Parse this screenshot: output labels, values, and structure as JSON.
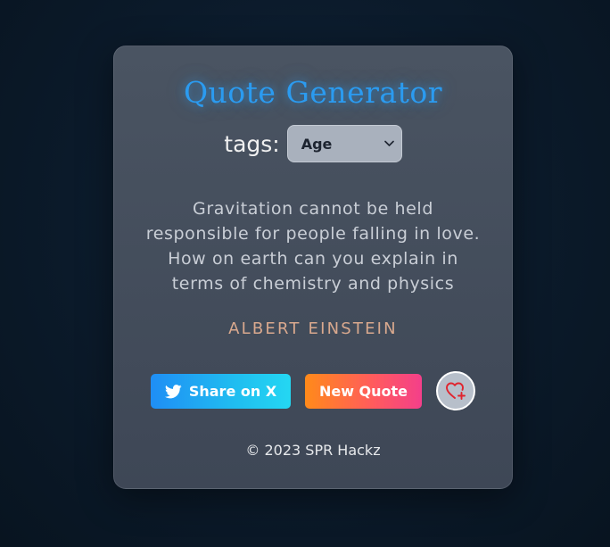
{
  "app": {
    "title": "Quote Generator"
  },
  "tags": {
    "label": "tags:",
    "selected": "Age"
  },
  "quote": {
    "text": "Gravitation cannot be held responsible for people falling in love. How on earth can you explain in terms of chemistry and physics",
    "author": "ALBERT EINSTEIN"
  },
  "actions": {
    "share_label": "Share on X",
    "new_quote_label": "New Quote"
  },
  "icons": {
    "share": "twitter-bird-icon",
    "favorite": "heart-plus-icon",
    "dropdown": "chevron-down-icon"
  },
  "colors": {
    "title": "#2b9bf0",
    "author": "#d9a98e",
    "share_start": "#1f8ef5",
    "share_end": "#24d7f2",
    "new_quote_start": "#ff8a1a",
    "new_quote_end": "#f43f8a",
    "favorite_heart": "#e0242e"
  },
  "footer": {
    "text": "© 2023 SPR Hackz"
  }
}
